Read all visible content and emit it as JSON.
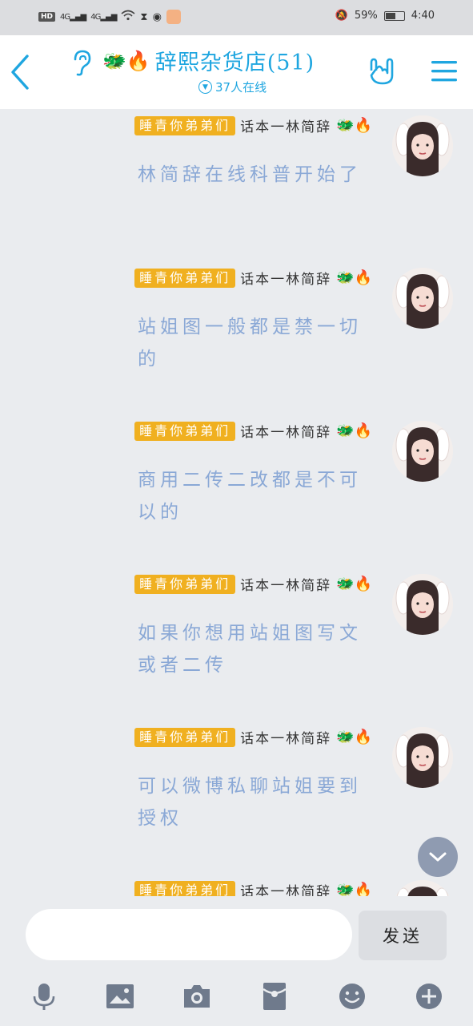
{
  "status_bar": {
    "hd_badge": "HD",
    "signal1": "4G",
    "signal2": "4G",
    "battery": "59%",
    "battery_level": 0.59,
    "time": "4:40"
  },
  "header": {
    "title": "辞熙杂货店(51)",
    "title_emoji": "🐲🔥",
    "online": "37人在线"
  },
  "messages": [
    {
      "title_badge": "睡青你弟弟们",
      "sender": "话本一林简辞",
      "sender_emoji": "🐲🔥",
      "text": "林简辞在线科普开始了"
    },
    {
      "title_badge": "睡青你弟弟们",
      "sender": "话本一林简辞",
      "sender_emoji": "🐲🔥",
      "text": "站姐图一般都是禁一切的"
    },
    {
      "title_badge": "睡青你弟弟们",
      "sender": "话本一林简辞",
      "sender_emoji": "🐲🔥",
      "text": "商用二传二改都是不可以的"
    },
    {
      "title_badge": "睡青你弟弟们",
      "sender": "话本一林简辞",
      "sender_emoji": "🐲🔥",
      "text": "如果你想用站姐图写文或者二传"
    },
    {
      "title_badge": "睡青你弟弟们",
      "sender": "话本一林简辞",
      "sender_emoji": "🐲🔥",
      "text": "可以微博私聊站姐要到授权"
    },
    {
      "title_badge": "睡青你弟弟们",
      "sender": "话本一林简辞",
      "sender_emoji": "🐲🔥",
      "text": ""
    }
  ],
  "input": {
    "value": "",
    "placeholder": "",
    "send_label": "发送"
  },
  "toolbar": {
    "icons": [
      "microphone-icon",
      "image-icon",
      "camera-icon",
      "red-packet-icon",
      "emoji-icon",
      "plus-icon"
    ]
  },
  "colors": {
    "accent": "#1fa6e0",
    "badge": "#f0b020",
    "message_text": "#8aa8d6",
    "background": "#eaecef"
  }
}
